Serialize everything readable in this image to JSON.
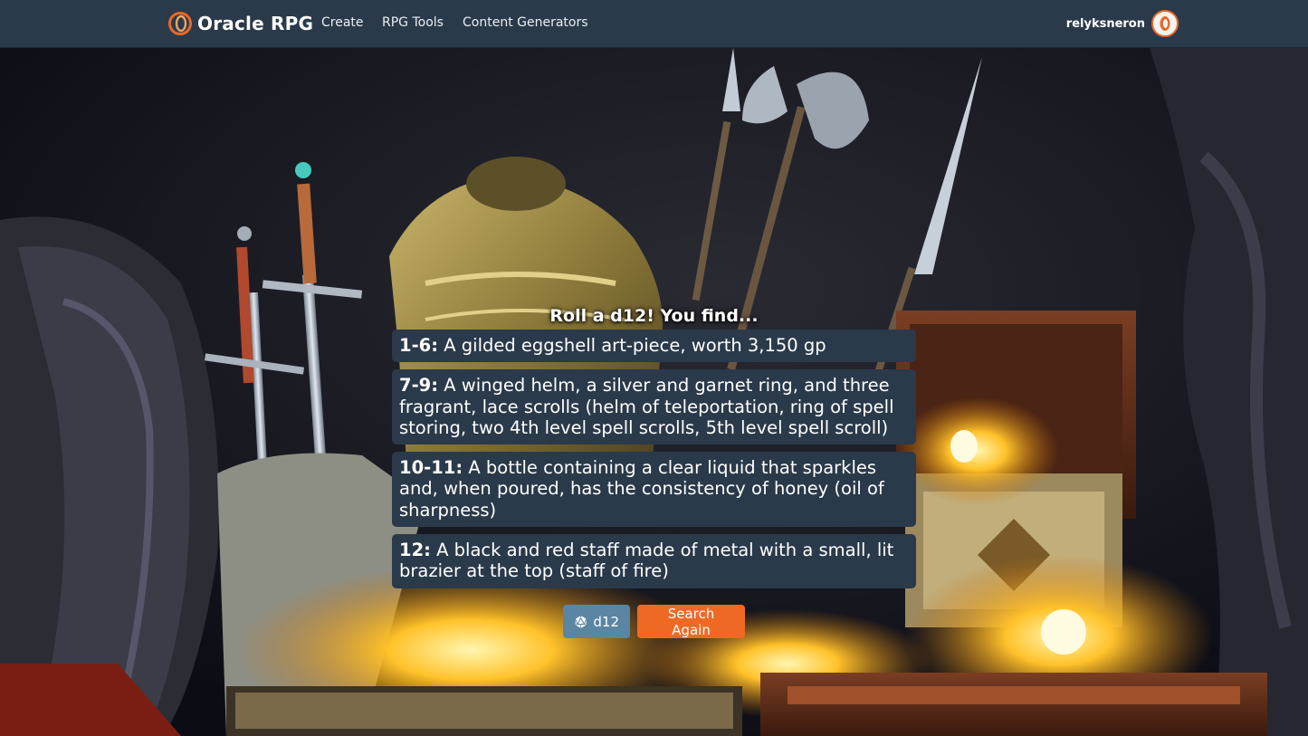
{
  "navbar": {
    "brand": "Oracle RPG",
    "links": [
      "Create",
      "RPG Tools",
      "Content Generators"
    ],
    "username": "relyksneron"
  },
  "result": {
    "heading": "Roll a d12! You find...",
    "entries": [
      {
        "range": "1-6:",
        "text": " A gilded eggshell art-piece, worth 3,150 gp"
      },
      {
        "range": "7-9:",
        "text": " A winged helm, a silver and garnet ring, and three fragrant, lace scrolls (helm of teleportation, ring of spell storing, two 4th level spell scrolls, 5th level spell scroll)"
      },
      {
        "range": "10-11:",
        "text": " A bottle containing a clear liquid that sparkles and, when poured, has the consistency of honey (oil of sharpness)"
      },
      {
        "range": "12:",
        "text": " A black and red staff made of metal with a small, lit brazier at the top (staff of fire)"
      }
    ]
  },
  "actions": {
    "die_label": "d12",
    "search_label": "Search Again"
  },
  "icons": {
    "logo": "oracle-ring-logo-icon",
    "die": "d20-die-icon",
    "avatar": "user-avatar-icon"
  },
  "colors": {
    "navbar": "#2a3a4a",
    "accent": "#ee6a24",
    "die_button": "#5a86a3",
    "entry_bg": "#2a3a4a"
  }
}
